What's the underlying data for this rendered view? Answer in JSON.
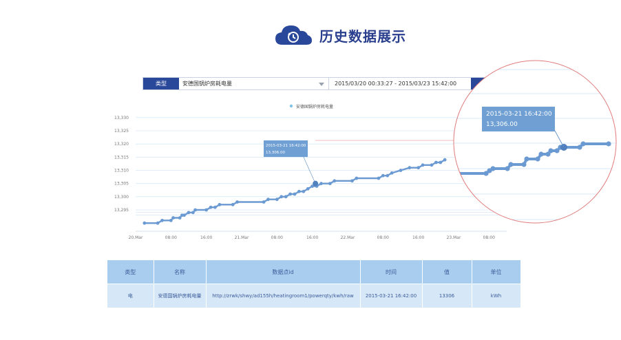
{
  "header": {
    "title": "历史数据展示",
    "icon": "cloud-history-icon"
  },
  "filter": {
    "type_label": "类型",
    "type_value": "安德国锅炉房耗电量",
    "date_range": "2015/03/20 00:33:27 - 2015/03/23 15:42:00"
  },
  "colors": {
    "accent": "#2a4899",
    "series": "#6b9ad2",
    "grid": "#d7e9f7",
    "zoom_circle": "#e17a7a"
  },
  "chart_data": {
    "type": "line",
    "title": "",
    "legend": "安德国锅炉房耗电量",
    "legend_position": "top-center",
    "xlabel": "",
    "ylabel": "",
    "ylim": [
      13289,
      13331
    ],
    "yticks": [
      "13,330",
      "13,325",
      "13,320",
      "13,315",
      "13,310",
      "13,305",
      "13,300",
      "13,295"
    ],
    "ytick_values": [
      13330,
      13325,
      13320,
      13315,
      13310,
      13305,
      13300,
      13295
    ],
    "xticks": [
      "20.Mar",
      "08:00",
      "16:00",
      "21.Mar",
      "08:00",
      "16:00",
      "22.Mar",
      "08:00",
      "16:00",
      "23.Mar",
      "08:00"
    ],
    "xtick_hours": [
      0,
      8,
      16,
      24,
      32,
      40,
      48,
      56,
      64,
      72,
      80
    ],
    "grid": true,
    "series": [
      {
        "name": "安德国锅炉房耗电量",
        "points": [
          [
            2,
            13290
          ],
          [
            5,
            13290
          ],
          [
            6,
            13291
          ],
          [
            8,
            13291
          ],
          [
            8.5,
            13292
          ],
          [
            10,
            13292
          ],
          [
            10.5,
            13293
          ],
          [
            11,
            13293
          ],
          [
            12,
            13294
          ],
          [
            13,
            13294
          ],
          [
            13.5,
            13295
          ],
          [
            16,
            13295
          ],
          [
            17,
            13296
          ],
          [
            18,
            13296
          ],
          [
            19,
            13297
          ],
          [
            22,
            13297
          ],
          [
            23,
            13298
          ],
          [
            29,
            13298
          ],
          [
            30,
            13299
          ],
          [
            32,
            13299
          ],
          [
            33,
            13300
          ],
          [
            34,
            13300
          ],
          [
            35,
            13301
          ],
          [
            36,
            13301
          ],
          [
            37,
            13302
          ],
          [
            38,
            13302
          ],
          [
            39,
            13303
          ],
          [
            40,
            13304
          ],
          [
            41,
            13304
          ],
          [
            42,
            13305
          ],
          [
            44,
            13305
          ],
          [
            45,
            13306
          ],
          [
            49,
            13306
          ],
          [
            50,
            13307
          ],
          [
            55,
            13307
          ],
          [
            56,
            13308
          ],
          [
            57,
            13308
          ],
          [
            58,
            13309
          ],
          [
            60,
            13310
          ],
          [
            62,
            13311
          ],
          [
            64,
            13311
          ],
          [
            65,
            13312
          ],
          [
            67,
            13312
          ],
          [
            68,
            13313
          ],
          [
            69,
            13313
          ],
          [
            70,
            13314
          ]
        ]
      }
    ],
    "tooltip": {
      "time": "2015-03-21 16:42:00",
      "value": "13,306.00",
      "x": 40.7,
      "y": 13305
    }
  },
  "table": {
    "headers": [
      "类型",
      "名称",
      "数据点id",
      "时间",
      "值",
      "单位"
    ],
    "rows": [
      [
        "电",
        "安德国锅炉房耗电量",
        "http://zrwk/shwy/ad155h/heatingroom1/powerqty/kwh/raw",
        "2015-03-21 16:42:00",
        "13306",
        "kWh"
      ]
    ]
  }
}
